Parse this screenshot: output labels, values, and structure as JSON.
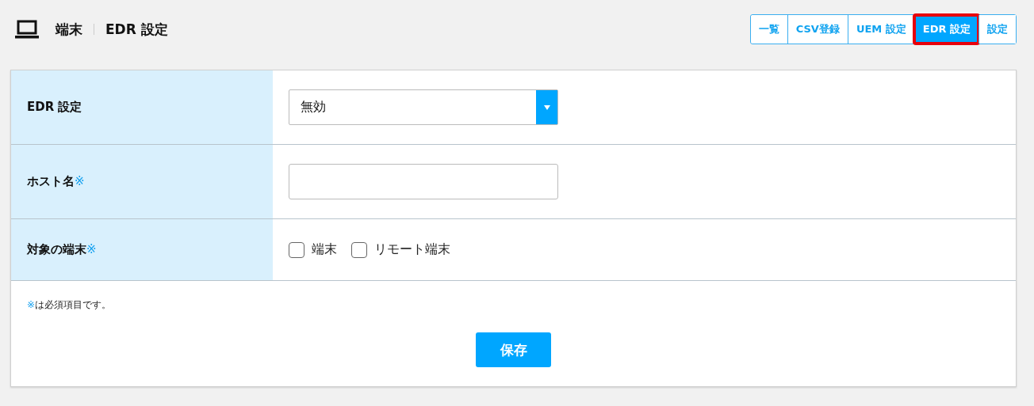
{
  "header": {
    "section": "端末",
    "page": "EDR 設定"
  },
  "tabs": [
    {
      "label": "一覧",
      "selected": false,
      "highlighted": false
    },
    {
      "label": "CSV登録",
      "selected": false,
      "highlighted": false
    },
    {
      "label": "UEM 設定",
      "selected": false,
      "highlighted": false
    },
    {
      "label": "EDR 設定",
      "selected": true,
      "highlighted": true
    },
    {
      "label": "設定",
      "selected": false,
      "highlighted": false
    }
  ],
  "form": [
    {
      "label": "EDR 設定",
      "kind": "select",
      "value": "無効"
    },
    {
      "label": "ホスト名",
      "kind": "text",
      "required_mark": "※"
    },
    {
      "label": "対象の端末",
      "kind": "checkboxes",
      "required_mark": "※",
      "options": [
        {
          "label": "端末",
          "checked": false
        },
        {
          "label": "リモート端末",
          "checked": false
        }
      ]
    }
  ],
  "note": {
    "mark": "※",
    "text": "は必須項目です。"
  },
  "save_button": "保存"
}
